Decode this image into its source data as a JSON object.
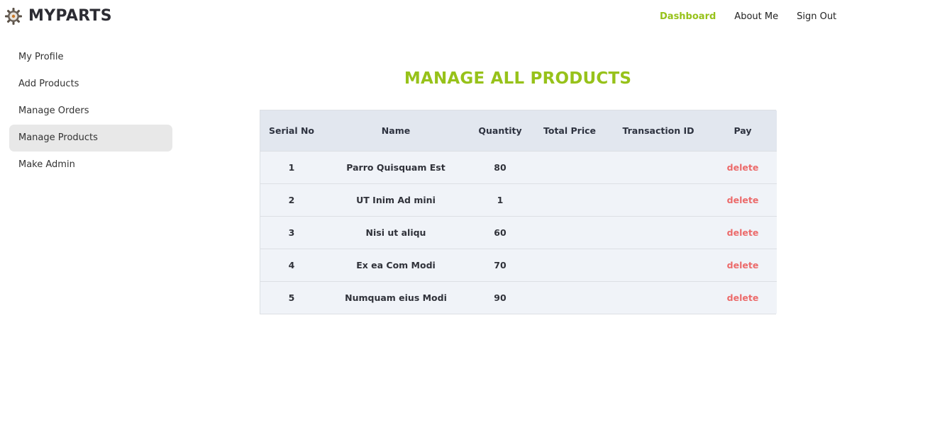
{
  "header": {
    "brand": "MYPARTS",
    "logo_icon": "gear-icon",
    "nav": [
      {
        "label": "Dashboard",
        "active": true
      },
      {
        "label": "About Me",
        "active": false
      },
      {
        "label": "Sign Out",
        "active": false
      }
    ]
  },
  "sidebar": {
    "items": [
      {
        "label": "My Profile",
        "active": false
      },
      {
        "label": "Add Products",
        "active": false
      },
      {
        "label": "Manage Orders",
        "active": false
      },
      {
        "label": "Manage Products",
        "active": true
      },
      {
        "label": "Make Admin",
        "active": false
      }
    ]
  },
  "main": {
    "title": "MANAGE ALL PRODUCTS",
    "columns": [
      "Serial No",
      "Name",
      "Quantity",
      "Total Price",
      "Transaction ID",
      "Pay"
    ],
    "rows": [
      {
        "serial": "1",
        "name": "Parro Quisquam Est",
        "quantity": "80",
        "total_price": "",
        "transaction_id": "",
        "action": "delete"
      },
      {
        "serial": "2",
        "name": "UT Inim Ad mini",
        "quantity": "1",
        "total_price": "",
        "transaction_id": "",
        "action": "delete"
      },
      {
        "serial": "3",
        "name": "Nisi ut aliqu",
        "quantity": "60",
        "total_price": "",
        "transaction_id": "",
        "action": "delete"
      },
      {
        "serial": "4",
        "name": "Ex ea Com Modi",
        "quantity": "70",
        "total_price": "",
        "transaction_id": "",
        "action": "delete"
      },
      {
        "serial": "5",
        "name": "Numquam eius Modi",
        "quantity": "90",
        "total_price": "",
        "transaction_id": "",
        "action": "delete"
      }
    ]
  },
  "colors": {
    "accent": "#97c21a",
    "delete": "#ec6b6b",
    "table_header_bg": "#e2e7ef",
    "table_row_bg": "#f0f3f8",
    "sidebar_active_bg": "#e8e8e8"
  }
}
